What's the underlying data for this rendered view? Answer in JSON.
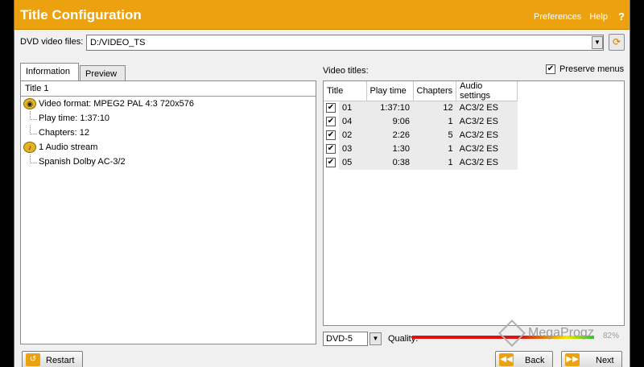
{
  "window": {
    "title": "Title Configuration",
    "links": [
      "Preferences",
      "Help"
    ],
    "help_icon": "?"
  },
  "files": {
    "label": "DVD video files:",
    "value": "D:/VIDEO_TS",
    "dropdown_icon": "chevron-down-icon",
    "browse_icon": "folder-refresh-icon"
  },
  "tabs": [
    {
      "label": "Information",
      "active": true
    },
    {
      "label": "Preview",
      "active": false
    }
  ],
  "info": {
    "header": "Title 1",
    "items": [
      {
        "icon": "video-eye-icon",
        "label": "Video format: MPEG2 PAL  4:3 720x576",
        "level": 0
      },
      {
        "label": "Play time: 1:37:10",
        "level": 1
      },
      {
        "label": "Chapters: 12",
        "level": 1
      },
      {
        "icon": "audio-note-icon",
        "label": "1 Audio stream",
        "level": 0
      },
      {
        "label": "Spanish Dolby AC-3/2",
        "level": 1
      }
    ]
  },
  "video_titles": {
    "label": "Video titles:",
    "preserve_menus": {
      "label": "Preserve menus",
      "checked": true
    },
    "columns": [
      "Title",
      "Play time",
      "Chapters",
      "Audio settings"
    ],
    "rows": [
      {
        "checked": true,
        "title": "01",
        "play_time": "1:37:10",
        "chapters": "12",
        "audio": "AC3/2 ES"
      },
      {
        "checked": true,
        "title": "04",
        "play_time": "9:06",
        "chapters": "1",
        "audio": "AC3/2 ES"
      },
      {
        "checked": true,
        "title": "02",
        "play_time": "2:26",
        "chapters": "5",
        "audio": "AC3/2 ES"
      },
      {
        "checked": true,
        "title": "03",
        "play_time": "1:30",
        "chapters": "1",
        "audio": "AC3/2 ES"
      },
      {
        "checked": true,
        "title": "05",
        "play_time": "0:38",
        "chapters": "1",
        "audio": "AC3/2 ES"
      }
    ]
  },
  "output": {
    "disc": "DVD-5",
    "quality_label": "Quality:",
    "quality_percent": "82%"
  },
  "buttons": {
    "restart": "Restart",
    "back": "Back",
    "next": "Next"
  },
  "watermark": "MegaProgz"
}
